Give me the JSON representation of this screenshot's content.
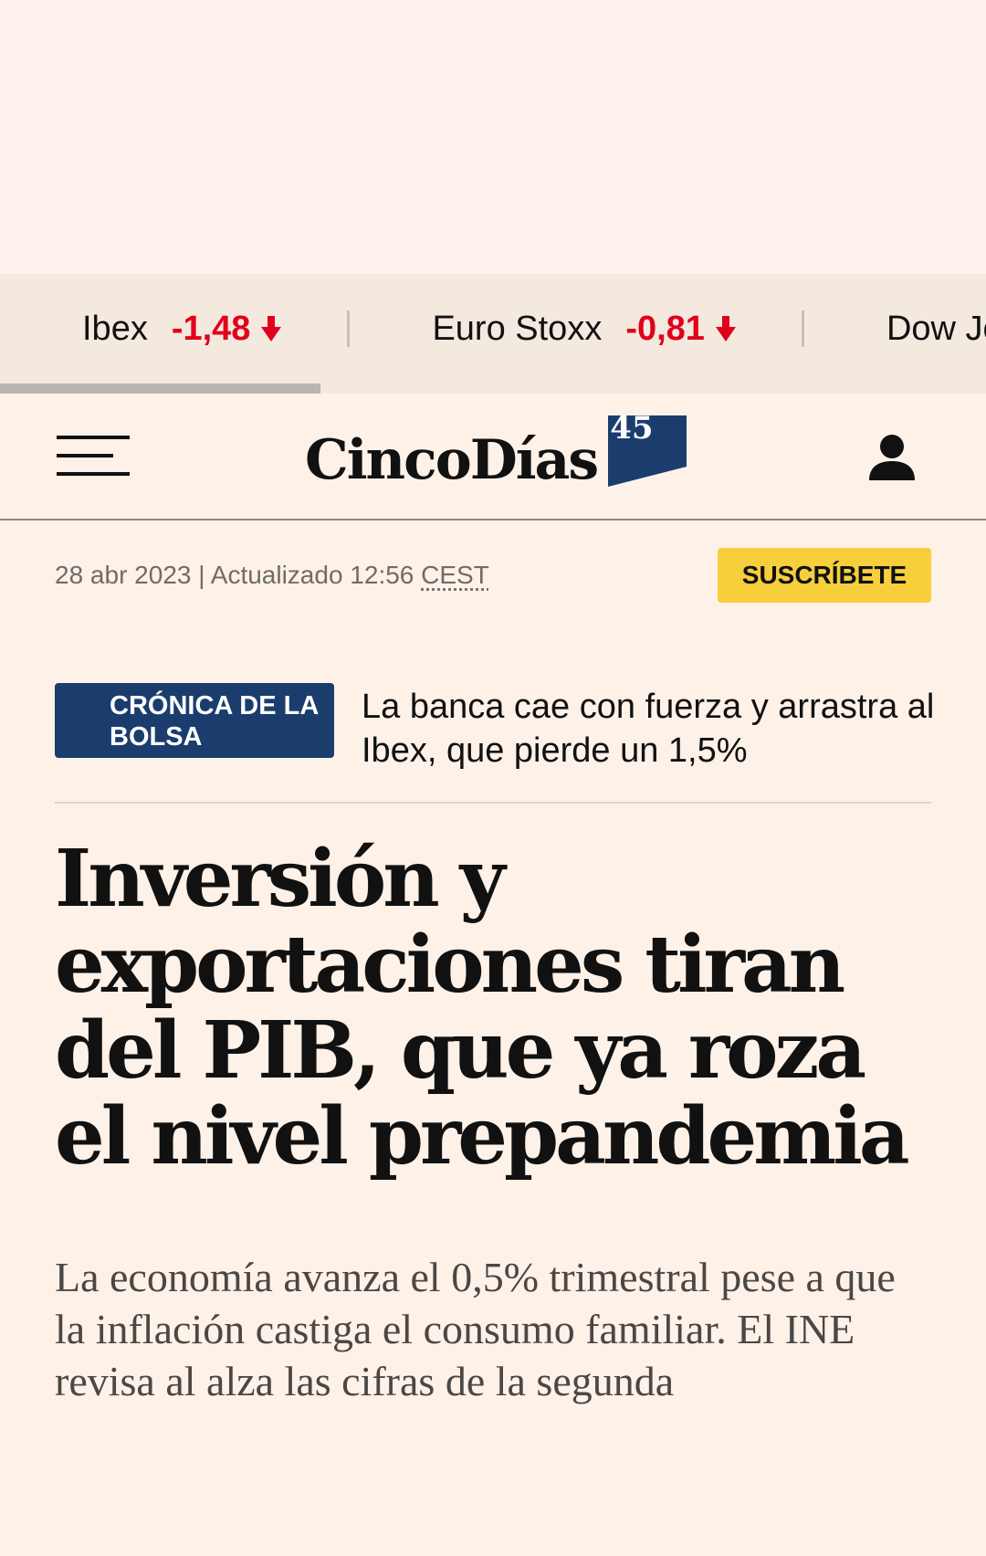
{
  "ticker": {
    "items": [
      {
        "name": "Ibex",
        "value": "-1,48",
        "direction": "down"
      },
      {
        "name": "Euro Stoxx",
        "value": "-0,81",
        "direction": "down"
      },
      {
        "name": "Dow Jo",
        "value": "",
        "direction": ""
      }
    ],
    "progress_fraction": 0.325,
    "negative_color": "#e1001a"
  },
  "header": {
    "logo_text": "CincoDías",
    "logo_badge": "45",
    "brand_color": "#1b3d6e",
    "menu_icon": "hamburger-menu-icon",
    "user_icon": "user-icon"
  },
  "meta": {
    "date": "28 abr 2023",
    "separator": "|",
    "updated_label": "Actualizado 12:56",
    "timezone": "CEST",
    "subscribe_label": "SUSCRÍBETE",
    "subscribe_color": "#f7cf3d"
  },
  "related": {
    "tag": "CRÓNICA DE LA BOLSA",
    "title": "La banca cae con fuerza y arrastra al Ibex, que pierde un 1,5%"
  },
  "article": {
    "headline": "Inversión y exportaciones tiran del PIB, que ya roza el nivel prepandemia",
    "subheadline": "La economía avanza el 0,5% trimestral pese a que la inflación castiga el consumo familiar. El INE revisa al alza las cifras de la segunda"
  }
}
